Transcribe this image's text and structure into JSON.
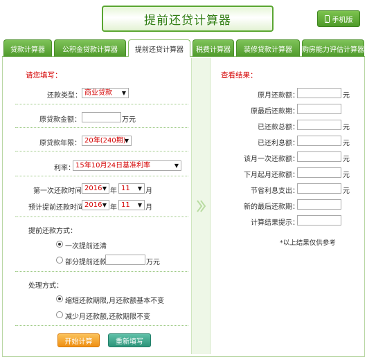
{
  "header": {
    "title": "提前还贷计算器",
    "mobile_button": "手机版"
  },
  "tabs": [
    {
      "label": "贷款计算器",
      "active": false
    },
    {
      "label": "公积金贷款计算器",
      "active": false
    },
    {
      "label": "提前还贷计算器",
      "active": true
    },
    {
      "label": "税费计算器",
      "active": false
    },
    {
      "label": "装修贷款计算器",
      "active": false
    },
    {
      "label": "购房能力评估计算器",
      "active": false
    }
  ],
  "form": {
    "section_title": "请您填写：",
    "loan_type_label": "还款类型：",
    "loan_type_value": "商业贷款",
    "amount_label": "原贷款金额：",
    "amount_unit": "万元",
    "years_label": "原贷款年限：",
    "years_value": "20年(240期)",
    "rate_label": "利率：",
    "rate_value": "15年10月24日基准利率",
    "first_pay_label": "第一次还款时间",
    "first_pay_year": "2016",
    "first_pay_month": "11",
    "prepay_label": "预计提前还款时间",
    "prepay_year": "2016",
    "prepay_month": "11",
    "year_unit": "年",
    "month_unit": "月",
    "prepay_method_label": "提前还款方式：",
    "prepay_option_full": "一次提前还清",
    "prepay_option_partial": "部分提前还款",
    "partial_unit": "万元",
    "handle_label": "处理方式：",
    "handle_option_shorten": "缩短还款期限,月还款额基本不变",
    "handle_option_reduce": "减少月还款额,还款期限不变",
    "start_button": "开始计算",
    "reset_button": "重新填写"
  },
  "results": {
    "section_title": "查看结果：",
    "rows": [
      {
        "label": "原月还款额：",
        "unit": "元"
      },
      {
        "label": "原最后还款期：",
        "unit": ""
      },
      {
        "label": "已还款总额：",
        "unit": "元"
      },
      {
        "label": "已还利息额：",
        "unit": "元"
      },
      {
        "label": "该月一次还款额：",
        "unit": "元"
      },
      {
        "label": "下月起月还款额：",
        "unit": "元"
      },
      {
        "label": "节省利息支出：",
        "unit": "元"
      },
      {
        "label": "新的最后还款期：",
        "unit": ""
      },
      {
        "label": "计算结果提示：",
        "unit": ""
      }
    ],
    "note": "*以上结果仅供参考"
  }
}
